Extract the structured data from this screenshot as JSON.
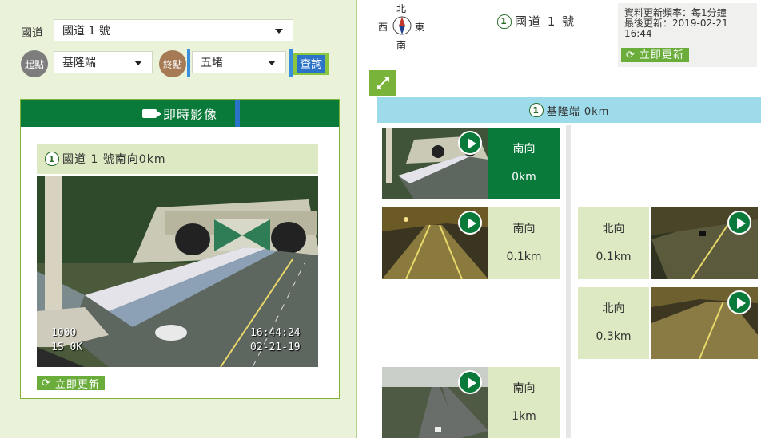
{
  "search": {
    "highway_label": "國道",
    "highway_value": "國道 1 號",
    "start_label": "起點",
    "start_value": "基隆端",
    "end_label": "終點",
    "end_value": "五堵",
    "query_label": "查詢"
  },
  "live": {
    "header": "即時影像",
    "cam_title": "國道 1 號南向0km",
    "osd_top_left": "1000",
    "osd_bottom_left": "1S  0K",
    "osd_time": "16:44:24",
    "osd_date": "02-21-19",
    "refresh_label": "立即更新"
  },
  "compass": {
    "north": "北",
    "south": "南",
    "east": "東",
    "west": "西"
  },
  "route": {
    "shield_number": "1",
    "title": "國道 1 號",
    "update_freq": "資料更新頻率：每1分鐘",
    "last_update": "最後更新：2019-02-21 16:44",
    "refresh_label": "立即更新",
    "start_bar": "基隆端 0km"
  },
  "cameras": [
    {
      "side": "south",
      "direction": "南向",
      "km": "0km",
      "active": true
    },
    {
      "side": "south",
      "direction": "南向",
      "km": "0.1km",
      "active": false
    },
    {
      "side": "north",
      "direction": "北向",
      "km": "0.1km",
      "active": false
    },
    {
      "side": "north",
      "direction": "北向",
      "km": "0.3km",
      "active": false
    },
    {
      "side": "south",
      "direction": "南向",
      "km": "1km",
      "active": false
    }
  ],
  "colors": {
    "accent_green": "#0a7a3a",
    "light_green": "#dde9c2",
    "button_green": "#6aad3a",
    "panel_bg": "#eaf3d9",
    "start_bar": "#9ddbea"
  }
}
